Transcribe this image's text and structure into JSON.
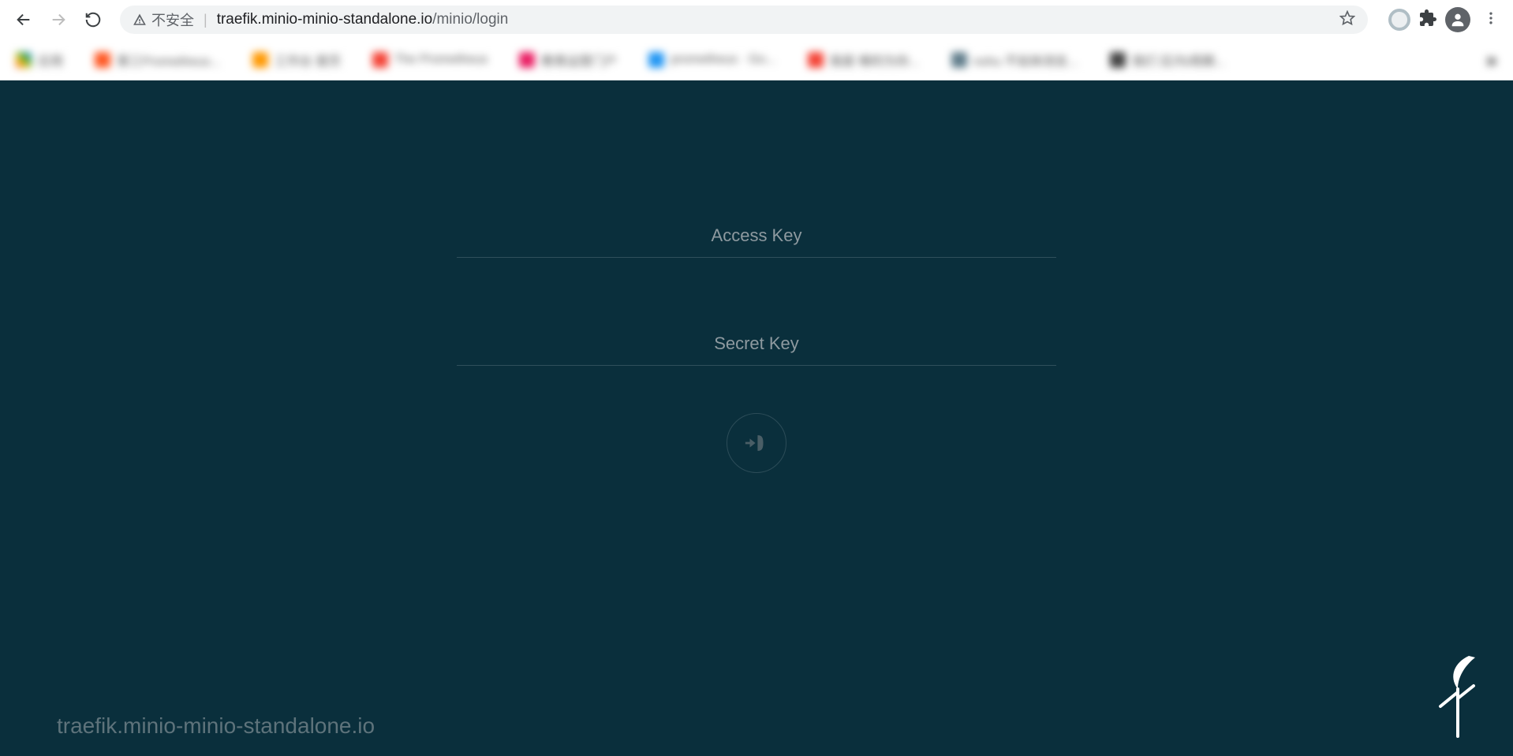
{
  "browser": {
    "security_label": "不安全",
    "url_host": "traefik.minio-minio-standalone.io",
    "url_path": "/minio/login"
  },
  "login": {
    "access_key_placeholder": "Access Key",
    "secret_key_placeholder": "Secret Key",
    "access_key_value": "",
    "secret_key_value": ""
  },
  "footer": {
    "host": "traefik.minio-minio-standalone.io"
  }
}
